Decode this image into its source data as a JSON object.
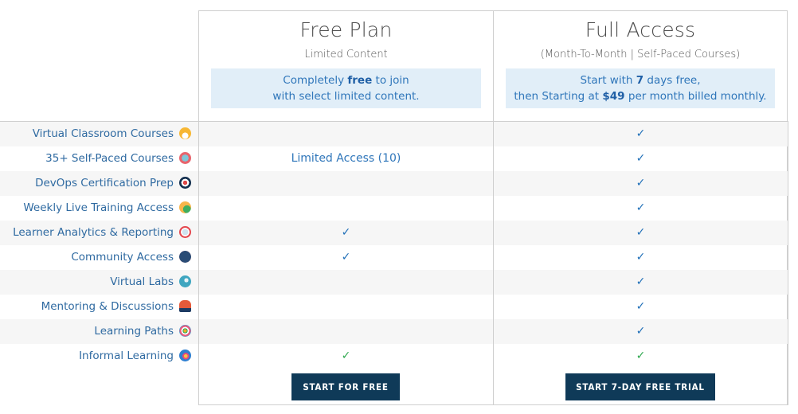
{
  "plans": [
    {
      "title": "Free Plan",
      "subtitle": "Limited Content",
      "box_line1_pre": "Completely ",
      "box_line1_bold": "free",
      "box_line1_post": " to join",
      "box_line2": "with select limited content.",
      "cta_label": "START FOR FREE"
    },
    {
      "title": "Full Access",
      "subtitle": "(Month-To-Month | Self-Paced Courses)",
      "box_line1_pre": "Start with ",
      "box_line1_bold": "7",
      "box_line1_post": " days free,",
      "box_line2_pre": "then Starting at ",
      "box_line2_bold": "$49",
      "box_line2_post": " per month billed monthly.",
      "cta_label": "START 7-DAY FREE TRIAL"
    }
  ],
  "features": [
    {
      "label": "Virtual Classroom Courses",
      "icon": "virtual-classroom-icon",
      "free": "",
      "full": "✓"
    },
    {
      "label": "35+ Self-Paced Courses",
      "icon": "self-paced-courses-icon",
      "free": "Limited Access (10)",
      "full": "✓"
    },
    {
      "label": "DevOps Certification Prep",
      "icon": "certification-target-icon",
      "free": "",
      "full": "✓"
    },
    {
      "label": "Weekly Live Training Access",
      "icon": "live-training-calendar-icon",
      "free": "",
      "full": "✓"
    },
    {
      "label": "Learner Analytics & Reporting",
      "icon": "analytics-icon",
      "free": "✓",
      "full": "✓"
    },
    {
      "label": "Community Access",
      "icon": "community-icon",
      "free": "✓",
      "full": "✓"
    },
    {
      "label": "Virtual Labs",
      "icon": "virtual-labs-icon",
      "free": "",
      "full": "✓"
    },
    {
      "label": "Mentoring & Discussions",
      "icon": "mentoring-icon",
      "free": "",
      "full": "✓"
    },
    {
      "label": "Learning Paths",
      "icon": "learning-paths-icon",
      "free": "",
      "full": "✓"
    },
    {
      "label": "Informal Learning",
      "icon": "informal-learning-icon",
      "free": "✓",
      "full": "✓"
    }
  ],
  "colors": {
    "cta_bg": "#0f3a58",
    "check_blue": "#1f6fb8",
    "check_green": "#2fa84f",
    "highlight_box": "#e1eef8"
  }
}
